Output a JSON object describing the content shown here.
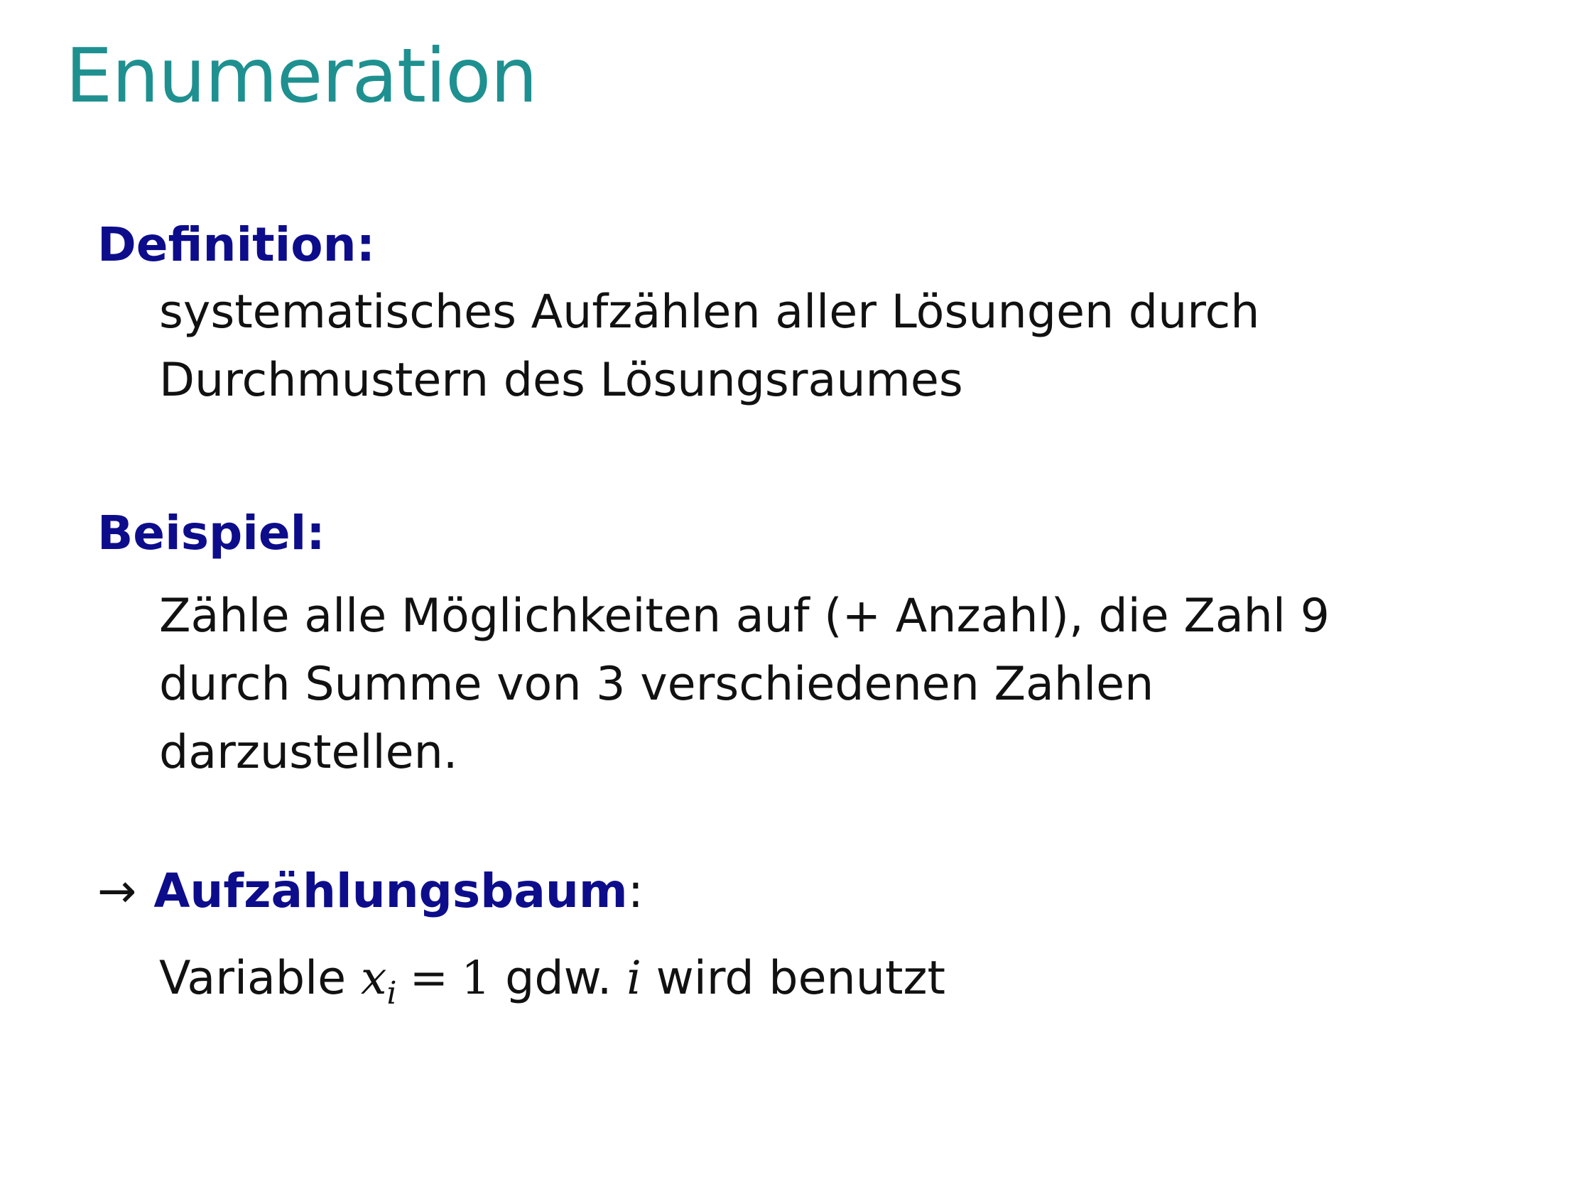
{
  "slide": {
    "title": "Enumeration",
    "definition": {
      "heading": "Definition:",
      "lines": [
        "systematisches Aufzählen aller Lösungen durch",
        "Durchmustern des Lösungsraumes"
      ]
    },
    "example": {
      "heading": "Beispiel:",
      "lines": [
        "Zähle alle Möglichkeiten auf (+ Anzahl), die Zahl 9",
        "durch Summe von 3 verschiedenen Zahlen",
        "darzustellen."
      ]
    },
    "tree": {
      "arrow": "→",
      "term": "Aufzählungsbaum",
      "colon": ":",
      "line_prefix": "Variable ",
      "var": "x",
      "sub": "i",
      "equals": "=",
      "one": "1",
      "middle": " gdw. ",
      "index_var": "i",
      "suffix": " wird benutzt"
    }
  }
}
